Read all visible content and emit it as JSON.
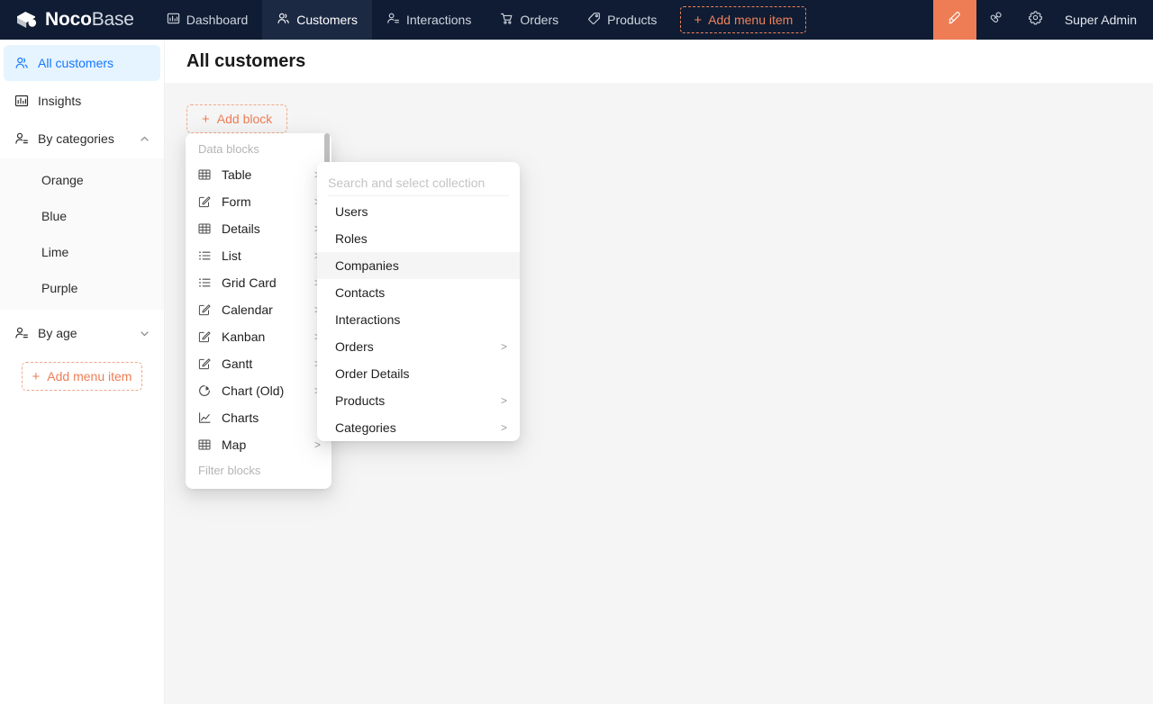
{
  "header": {
    "brand": {
      "noco": "Noco",
      "base": "Base",
      "logo_icon": "nocobase-cube-logo"
    },
    "tabs": [
      {
        "label": "Dashboard",
        "icon": "bar-chart-icon",
        "active": false
      },
      {
        "label": "Customers",
        "icon": "user-group-icon",
        "active": true
      },
      {
        "label": "Interactions",
        "icon": "user-switch-icon",
        "active": false
      },
      {
        "label": "Orders",
        "icon": "shopping-cart-icon",
        "active": false
      },
      {
        "label": "Products",
        "icon": "tag-icon",
        "active": false
      }
    ],
    "add_menu_item_label": "Add menu item",
    "plus": "+",
    "ui_editor_icon": "highlighter-icon",
    "plugin_icon": "plugin-link-icon",
    "settings_icon": "gear-icon",
    "user_label": "Super Admin",
    "background_color": "#0f1c33",
    "active_tab_color": "#1b2943",
    "accent_color": "#ee7d55"
  },
  "sidebar": {
    "items": [
      {
        "label": "All customers",
        "icon": "user-group-icon",
        "active": true,
        "chevron": ""
      },
      {
        "label": "Insights",
        "icon": "bar-chart-icon",
        "active": false,
        "chevron": ""
      },
      {
        "label": "By categories",
        "icon": "user-switch-icon",
        "active": false,
        "chevron": "chevron-up-icon"
      }
    ],
    "sub_items": [
      {
        "label": "Orange"
      },
      {
        "label": "Blue"
      },
      {
        "label": "Lime"
      },
      {
        "label": "Purple"
      }
    ],
    "collapsed_group": {
      "label": "By age",
      "icon": "user-switch-icon",
      "chevron": "chevron-down-icon"
    },
    "add_menu_item_label": "Add menu item",
    "plus": "+",
    "active_bg_color": "#e6f4ff",
    "active_text_color": "#1677ff"
  },
  "page": {
    "title": "All customers",
    "add_block_label": "Add block",
    "plus": "+",
    "background_color": "#f5f5f5"
  },
  "block_menu": {
    "group_title": "Data blocks",
    "items": [
      {
        "label": "Table",
        "icon": "table-grid-icon",
        "arrow": ">"
      },
      {
        "label": "Form",
        "icon": "form-edit-icon",
        "arrow": ">"
      },
      {
        "label": "Details",
        "icon": "table-grid-icon",
        "arrow": ">"
      },
      {
        "label": "List",
        "icon": "list-icon",
        "arrow": ">"
      },
      {
        "label": "Grid Card",
        "icon": "list-icon",
        "arrow": ">"
      },
      {
        "label": "Calendar",
        "icon": "form-edit-icon",
        "arrow": ">"
      },
      {
        "label": "Kanban",
        "icon": "form-edit-icon",
        "arrow": ">"
      },
      {
        "label": "Gantt",
        "icon": "form-edit-icon",
        "arrow": ">"
      },
      {
        "label": "Chart (Old)",
        "icon": "pie-chart-icon",
        "arrow": ">"
      },
      {
        "label": "Charts",
        "icon": "line-chart-icon",
        "arrow": ""
      },
      {
        "label": "Map",
        "icon": "table-grid-icon",
        "arrow": ">"
      }
    ],
    "footer_group_title": "Filter blocks"
  },
  "collection_menu": {
    "search_placeholder": "Search and select collection",
    "search_value": "",
    "items": [
      {
        "label": "Users",
        "arrow": "",
        "selected": false
      },
      {
        "label": "Roles",
        "arrow": "",
        "selected": false
      },
      {
        "label": "Companies",
        "arrow": "",
        "selected": true
      },
      {
        "label": "Contacts",
        "arrow": "",
        "selected": false
      },
      {
        "label": "Interactions",
        "arrow": "",
        "selected": false
      },
      {
        "label": "Orders",
        "arrow": ">",
        "selected": false
      },
      {
        "label": "Order Details",
        "arrow": "",
        "selected": false
      },
      {
        "label": "Products",
        "arrow": ">",
        "selected": false
      },
      {
        "label": "Categories",
        "arrow": ">",
        "selected": false
      }
    ]
  }
}
